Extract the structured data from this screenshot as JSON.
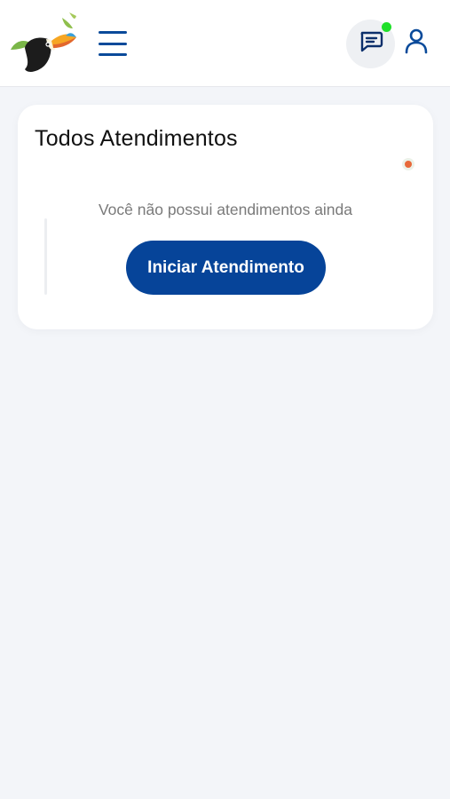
{
  "header": {
    "logo": "toucan-logo",
    "menu_icon": "hamburger-menu-icon",
    "chat_icon": "chat-icon",
    "user_icon": "user-icon",
    "colors": {
      "accent": "#0a4a9a",
      "online": "#20e02a"
    }
  },
  "main": {
    "card": {
      "title": "Todos Atendimentos",
      "empty_message": "Você não possui atendimentos ainda",
      "start_button_label": "Iniciar Atendimento",
      "status_color": "#e8693a"
    }
  },
  "colors": {
    "background": "#f3f5f9",
    "button": "#064499"
  }
}
